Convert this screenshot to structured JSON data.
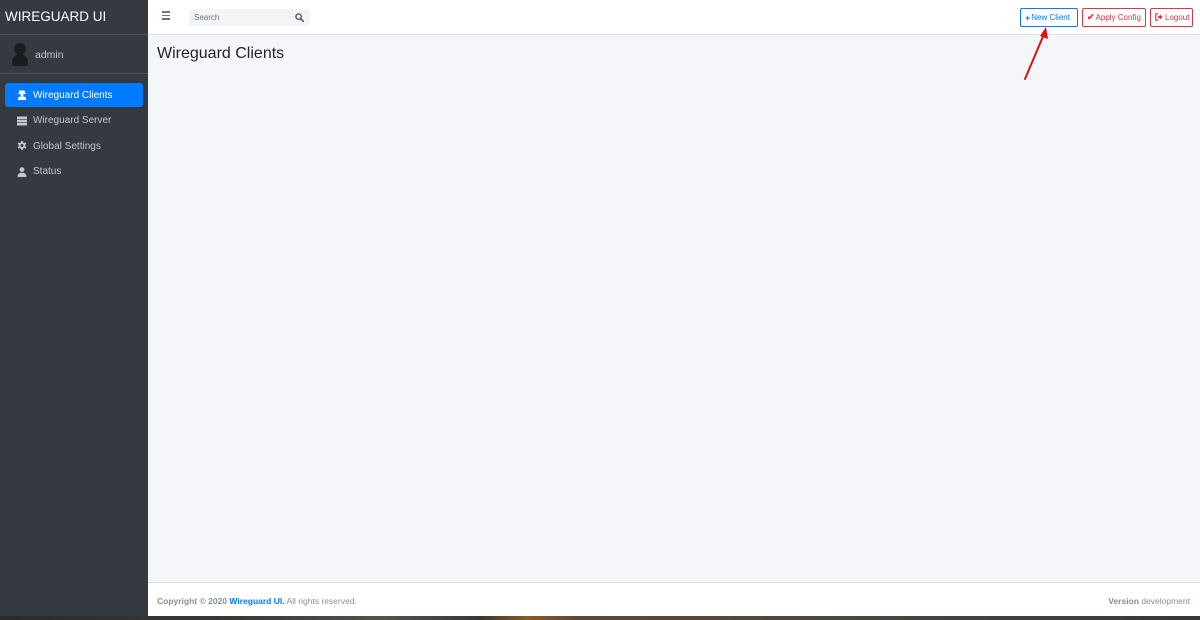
{
  "sidebar": {
    "brand": "WIREGUARD UI",
    "user": {
      "name": "admin",
      "icon": "user-avatar-icon"
    },
    "items": [
      {
        "label": "Wireguard Clients",
        "icon": "user-secret-icon",
        "active": true
      },
      {
        "label": "Wireguard Server",
        "icon": "server-icon",
        "active": false
      },
      {
        "label": "Global Settings",
        "icon": "gear-icon",
        "active": false
      },
      {
        "label": "Status",
        "icon": "user-icon",
        "active": false
      }
    ]
  },
  "header": {
    "menu_icon": "hamburger-icon",
    "search": {
      "placeholder": "Search",
      "value": "",
      "icon": "search-icon"
    },
    "buttons": {
      "new_client": {
        "label": "New Client",
        "icon": "plus-icon"
      },
      "apply_config": {
        "label": "Apply Config",
        "icon": "check-icon"
      },
      "logout": {
        "label": "Logout",
        "icon": "sign-out-icon"
      }
    }
  },
  "main": {
    "title": "Wireguard Clients"
  },
  "footer": {
    "copyright_prefix": "Copyright © 2020",
    "copyright_link": "Wireguard UI.",
    "copyright_suffix": "All rights reserved.",
    "version_label": "Version",
    "version_value": "development"
  },
  "colors": {
    "sidebar_bg": "#343a40",
    "primary": "#007bff",
    "danger": "#dc3545",
    "content_bg": "#f4f6f9",
    "annotation_arrow": "#e01010"
  }
}
